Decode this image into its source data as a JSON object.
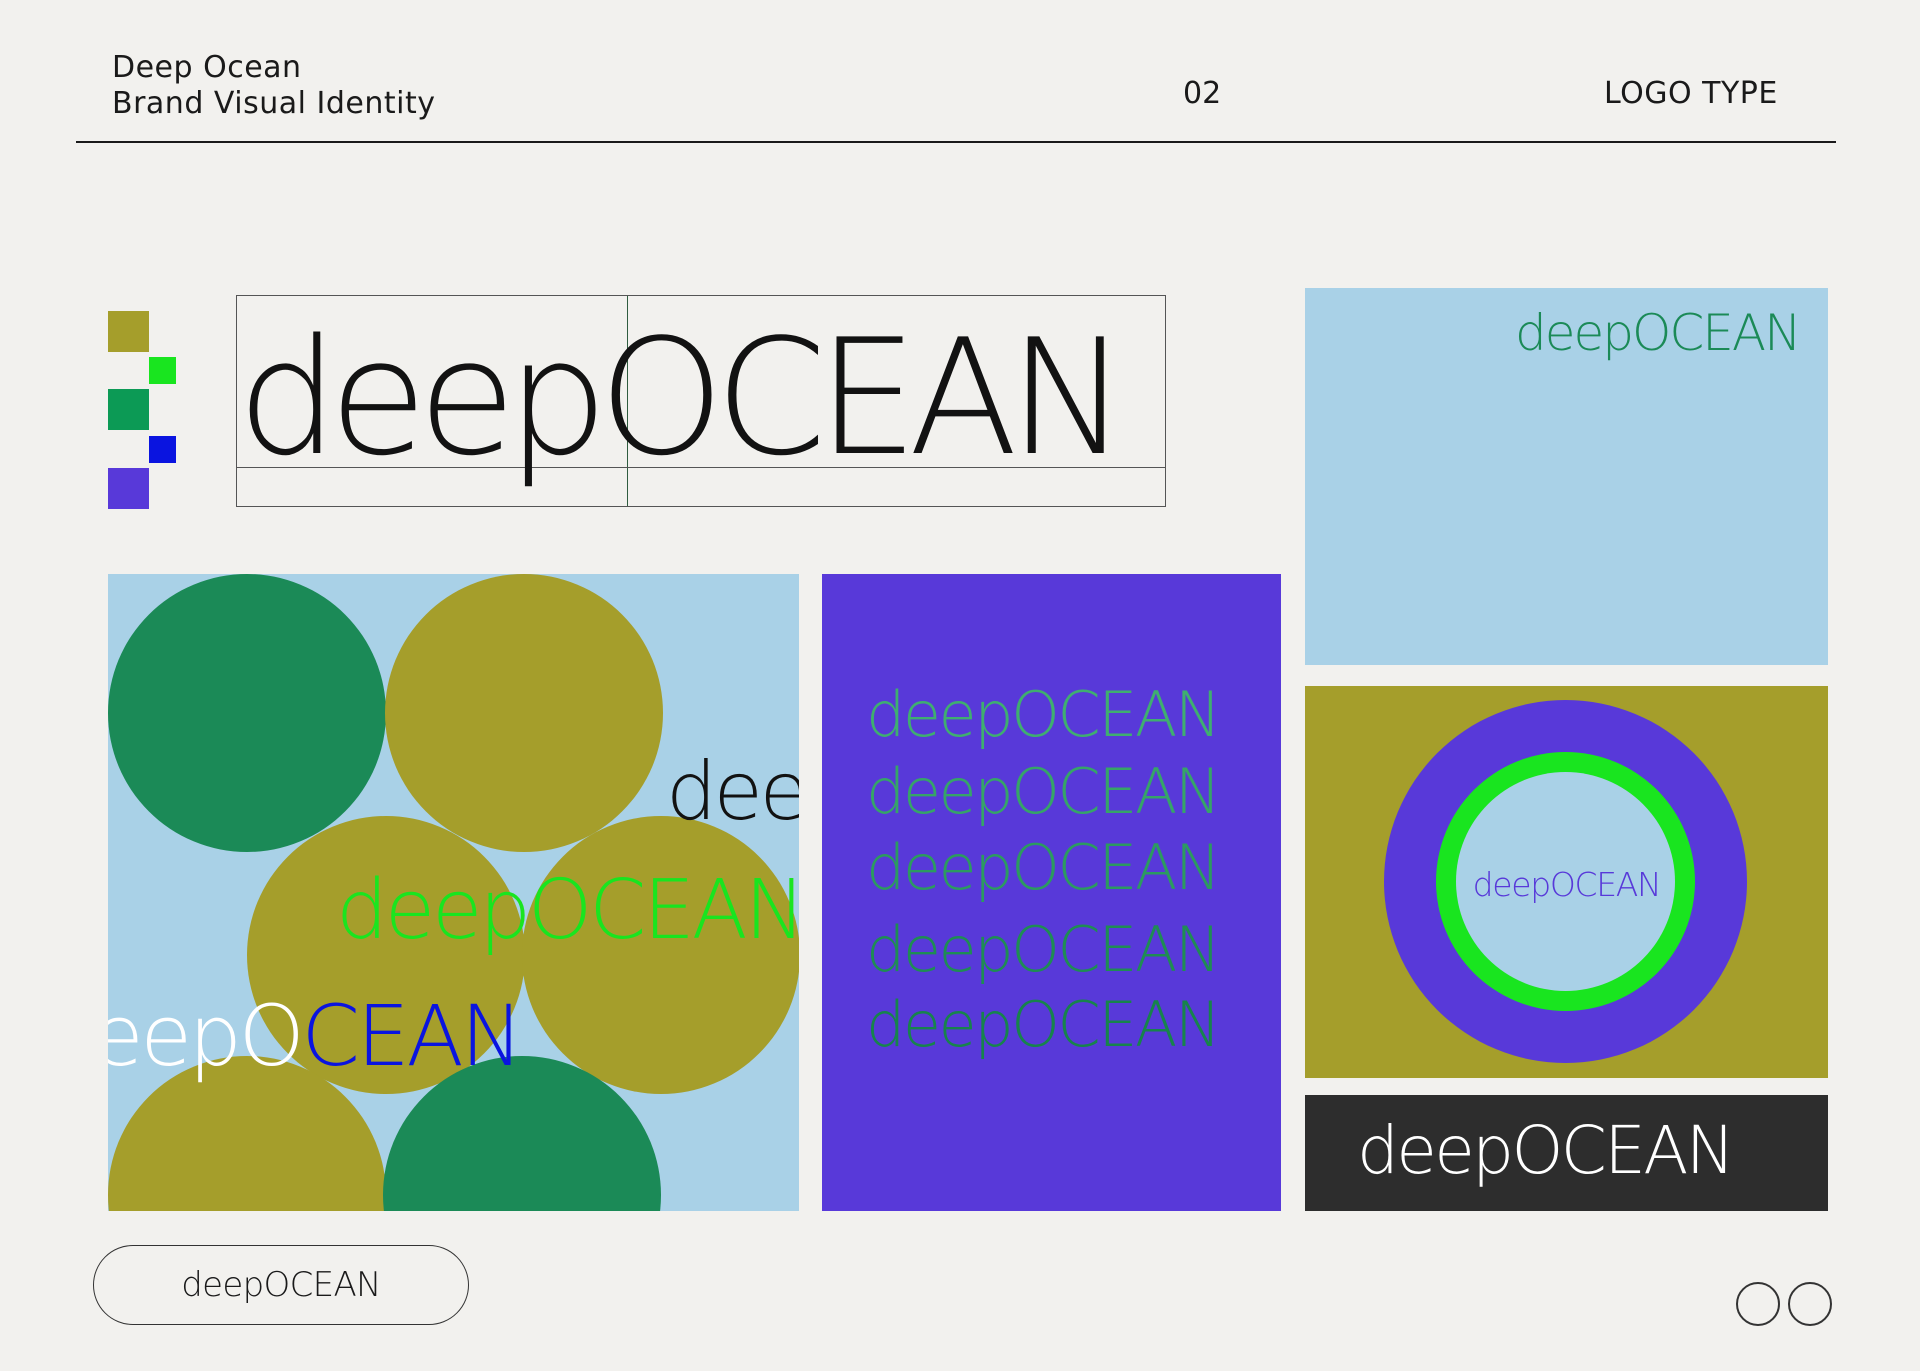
{
  "header": {
    "title_line1": "Deep Ocean",
    "title_line2": "Brand Visual Identity",
    "page_number": "02",
    "section": "LOGO TYPE"
  },
  "logo_text": "deepOCEAN",
  "logo_partial_left": "dee",
  "logo_partial_cut": "eepOCEAN",
  "pill_label": "deepOCEAN",
  "colors": {
    "background": "#f2f1ee",
    "olive": "#a59e2b",
    "green": "#1b8a57",
    "neon_green": "#19e51f",
    "blue": "#0a14e0",
    "violet": "#5839d9",
    "sky": "#a9d1e7",
    "dark": "#2d2d2d"
  }
}
